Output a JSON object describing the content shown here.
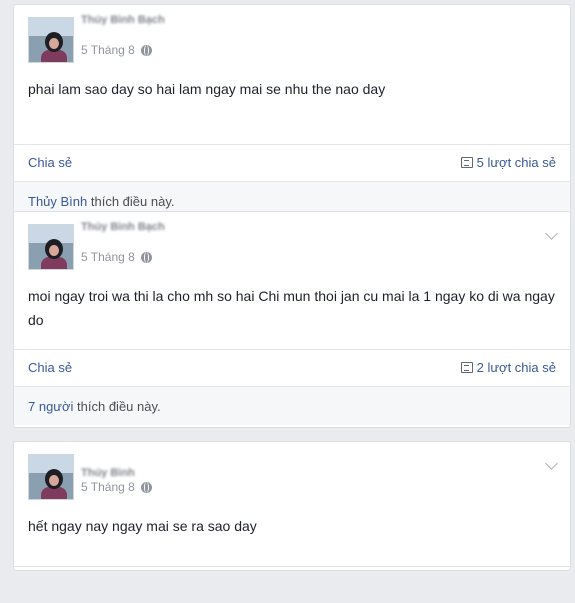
{
  "posts": [
    {
      "author": "Thủy Bình Bạch",
      "date": "5 Tháng 8",
      "text": "phai lam sao day so hai lam ngay mai se nhu the nao day",
      "share_label": "Chia sẻ",
      "share_count": "5 lượt chia sẻ",
      "likes_actor": "Thủy Bình",
      "likes_suffix": " thích điều này.",
      "has_chevron": false
    },
    {
      "author": "Thủy Bình Bạch",
      "date": "5 Tháng 8",
      "text": "moi ngay troi wa thi la cho mh so hai Chi mun thoi jan cu mai la 1 ngay ko di wa ngay do",
      "share_label": "Chia sẻ",
      "share_count": "2 lượt chia sẻ",
      "likes_actor": "7 người",
      "likes_suffix": " thích điều này.",
      "has_chevron": true
    },
    {
      "author": "Thủy Bình",
      "date": "5 Tháng 8",
      "text": "hết ngay nay ngay mai se ra sao day",
      "has_chevron": true
    }
  ],
  "icons": {
    "privacy": "globe-icon",
    "share_count": "share-icon",
    "menu": "chevron-down-icon"
  },
  "colors": {
    "link": "#385898",
    "meta": "#90949c",
    "background": "#e9ebee"
  }
}
